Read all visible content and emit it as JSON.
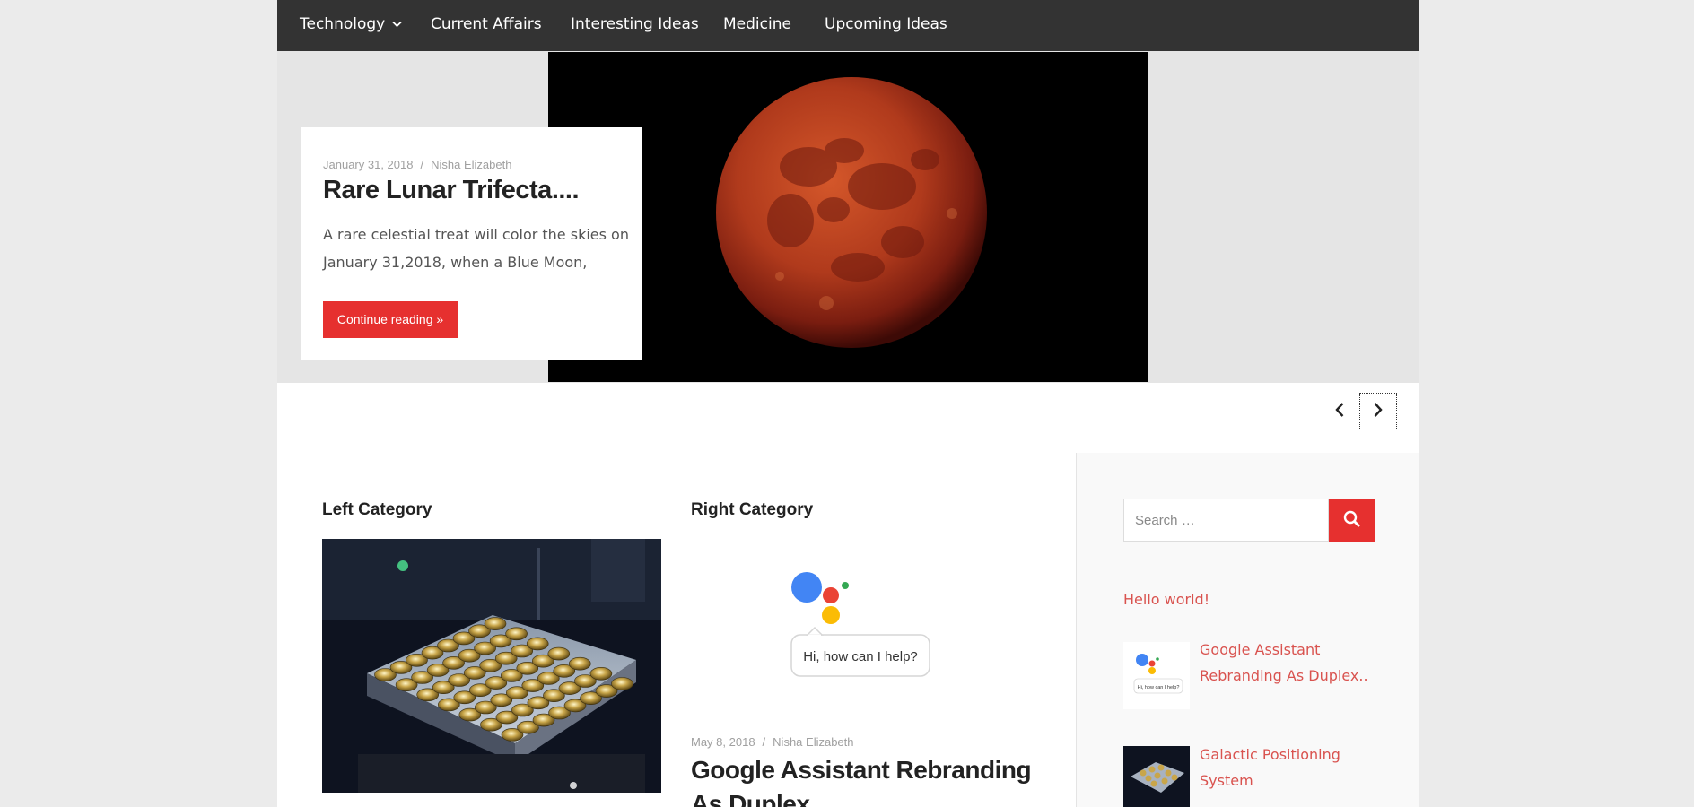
{
  "nav": {
    "items": [
      {
        "label": "Technology",
        "has_dropdown": true
      },
      {
        "label": "Current Affairs"
      },
      {
        "label": "Interesting Ideas"
      },
      {
        "label": "Medicine"
      },
      {
        "label": "Upcoming Ideas"
      }
    ]
  },
  "hero": {
    "date": "January 31, 2018",
    "separator": "/",
    "author": "Nisha Elizabeth",
    "title": "Rare Lunar Trifecta....",
    "excerpt": "A rare celestial treat will color the skies on January 31,2018, when a Blue Moon,",
    "button_label": "Continue reading »",
    "image_icon": "blood-moon-image"
  },
  "slider": {
    "prev_icon": "chevron-left-icon",
    "next_icon": "chevron-right-icon"
  },
  "left_category": {
    "title": "Left Category",
    "image_icon": "satellite-array-image"
  },
  "right_category": {
    "title": "Right Category",
    "assistant_bubble": "Hi, how can I help?",
    "date": "May 8, 2018",
    "separator": "/",
    "author": "Nisha Elizabeth",
    "post_title": "Google Assistant Rebranding As Duplex.."
  },
  "sidebar": {
    "search_placeholder": "Search …",
    "search_icon": "search-icon",
    "hello_link": "Hello world!",
    "thumb_bubble": "Hi, how can I help?",
    "posts": [
      {
        "title": "Google Assistant Rebranding As Duplex.."
      },
      {
        "title": "Galactic Positioning System"
      }
    ]
  },
  "colors": {
    "accent": "#e6302f",
    "link": "#d9534f",
    "nav_bg": "#333333",
    "hero_bg": "#e5e5e5",
    "page_bg": "#ebebeb"
  }
}
